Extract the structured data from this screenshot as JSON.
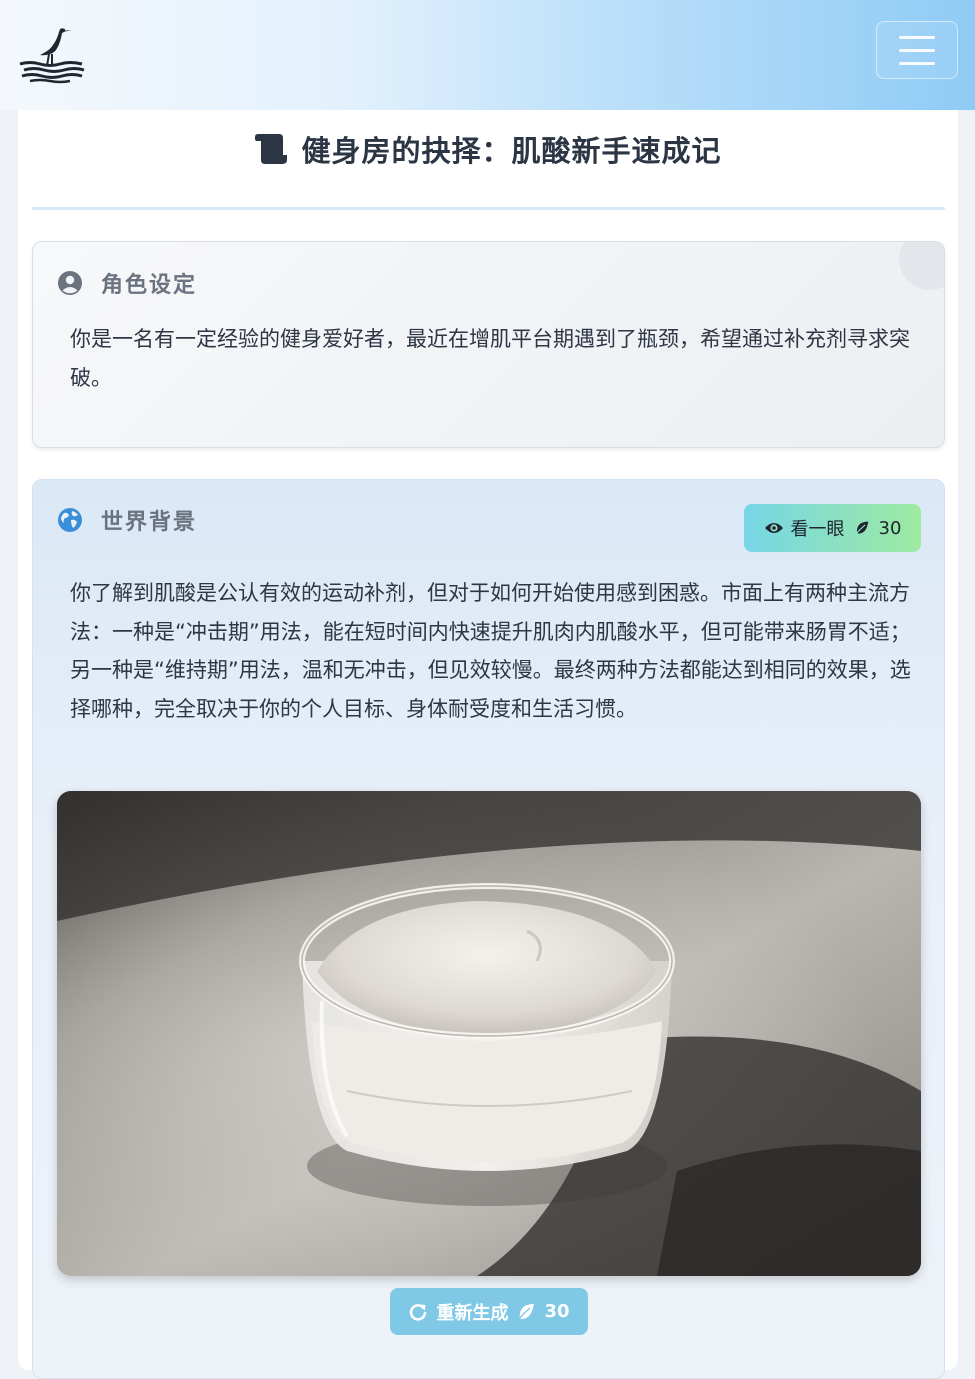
{
  "header": {
    "logo_icon": "heron-on-water-logo",
    "menu_icon": "hamburger-menu-icon"
  },
  "page": {
    "title_icon": "scroll-icon",
    "title": "健身房的抉择：肌酸新手速成记"
  },
  "role_panel": {
    "icon": "user-circle-icon",
    "label": "角色设定",
    "text": "你是一名有一定经验的健身爱好者，最近在增肌平台期遇到了瓶颈，希望通过补充剂寻求突破。"
  },
  "world_panel": {
    "icon": "globe-icon",
    "label": "世界背景",
    "peek_button": {
      "icon": "eye-icon",
      "label": "看一眼",
      "cost_icon": "leaf-icon",
      "cost": "30"
    },
    "text": "你了解到肌酸是公认有效的运动补剂，但对于如何开始使用感到困惑。市面上有两种主流方法：一种是“冲击期”用法，能在短时间内快速提升肌肉内肌酸水平，但可能带来肠胃不适；另一种是“维持期”用法，温和无冲击，但见效较慢。最终两种方法都能达到相同的效果，选择哪种，完全取决于你的个人目标、身体耐受度和生活习惯。",
    "image_subject": "glass-bowl-of-white-powder",
    "regen_button": {
      "icon": "redo-icon",
      "label": "重新生成",
      "cost_icon": "leaf-icon",
      "cost": "30"
    }
  },
  "colors": {
    "header_gradient_end": "#8fcbf6",
    "peek_gradient_start": "#76d6e6",
    "peek_gradient_end": "#9eeaa0",
    "regen_bg": "#7fc8e6",
    "globe_blue": "#3b8fd9"
  }
}
